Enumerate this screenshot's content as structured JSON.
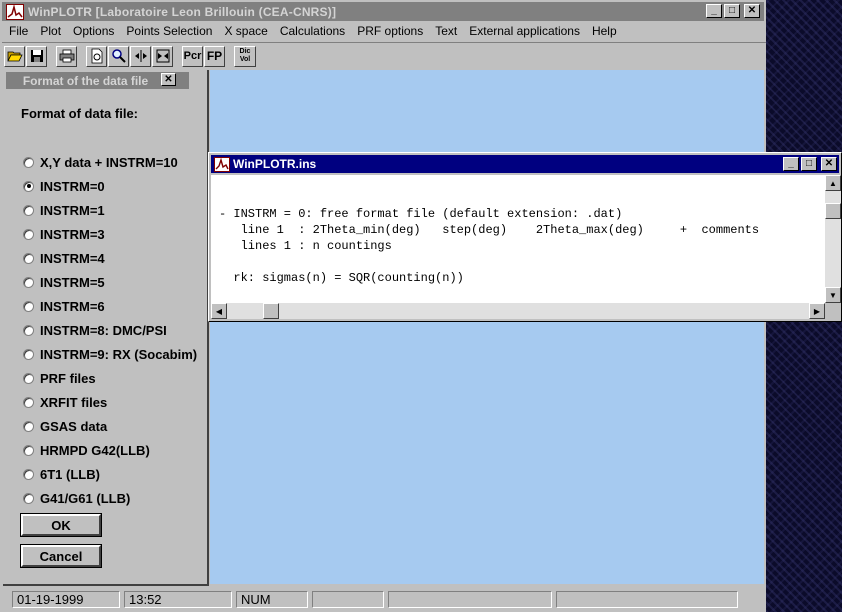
{
  "app": {
    "title": "WinPLOTR [Laboratoire Leon Brillouin (CEA-CNRS)]",
    "window_buttons": {
      "minimize": "_",
      "maximize": "□",
      "close": "✕"
    }
  },
  "menu": [
    {
      "label": "File"
    },
    {
      "label": "Plot"
    },
    {
      "label": "Options"
    },
    {
      "label": "Points Selection"
    },
    {
      "label": "X space"
    },
    {
      "label": "Calculations"
    },
    {
      "label": "PRF options"
    },
    {
      "label": "Text"
    },
    {
      "label": "External applications"
    },
    {
      "label": "Help"
    }
  ],
  "toolbar": {
    "open_icon": "folder-open-icon",
    "save_icon": "floppy-icon",
    "print_icon": "printer-icon",
    "preview_icon": "page-preview-icon",
    "zoom_icon": "magnifier-icon",
    "pcr_label": "Pcr",
    "fp_label": "FP",
    "dicvol_label": "Dic Vol"
  },
  "dialog": {
    "title": "Format of the data file",
    "heading": "Format of data file:",
    "options": [
      {
        "label": "X,Y data + INSTRM=10",
        "checked": false
      },
      {
        "label": "INSTRM=0",
        "checked": true
      },
      {
        "label": "INSTRM=1",
        "checked": false
      },
      {
        "label": "INSTRM=3",
        "checked": false
      },
      {
        "label": "INSTRM=4",
        "checked": false
      },
      {
        "label": "INSTRM=5",
        "checked": false
      },
      {
        "label": "INSTRM=6",
        "checked": false
      },
      {
        "label": "INSTRM=8: DMC/PSI",
        "checked": false
      },
      {
        "label": "INSTRM=9: RX (Socabim)",
        "checked": false
      },
      {
        "label": "PRF files",
        "checked": false
      },
      {
        "label": "XRFIT files",
        "checked": false
      },
      {
        "label": "GSAS data",
        "checked": false
      },
      {
        "label": "HRMPD G42(LLB)",
        "checked": false
      },
      {
        "label": "6T1 (LLB)",
        "checked": false
      },
      {
        "label": "G41/G61 (LLB)",
        "checked": false
      }
    ],
    "ok_label": "OK",
    "cancel_label": "Cancel"
  },
  "child_window": {
    "title": "WinPLOTR.ins",
    "lines": [
      "- INSTRM = 0: free format file (default extension: .dat)",
      "   line 1  : 2Theta_min(deg)   step(deg)    2Theta_max(deg)     +  comments",
      "   lines 1 : n countings",
      "  rk: sigmas(n) = SQR(counting(n))"
    ]
  },
  "status": {
    "date": "01-19-1999",
    "time": "13:52",
    "num": "NUM"
  }
}
